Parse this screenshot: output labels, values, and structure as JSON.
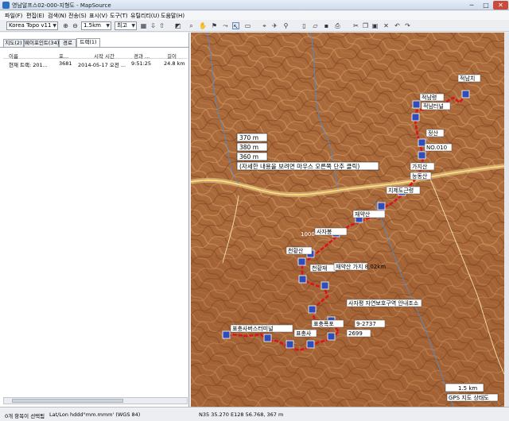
{
  "window": {
    "title": "영남알프스02-000-지형도 - MapSource"
  },
  "menu": [
    "파일(F)",
    "편집(E)",
    "검색(N)",
    "전송(S)",
    "표시(V)",
    "도구(T)",
    "유틸리티(U)",
    "도움말(H)"
  ],
  "toolbar": {
    "map_product": "Korea Topo v11",
    "zoom_scale": "1.5km",
    "detail": "최고"
  },
  "tabs": [
    "지도(2)",
    "웨이포인트(34)",
    "경로",
    "트랙(1)"
  ],
  "track_list": {
    "columns": [
      "이름",
      "포...",
      "시작 시간",
      "경과 ...",
      "길이"
    ],
    "rows": [
      [
        "현재 트랙: 201...",
        "3681",
        "2014-05-17 오전 ...",
        "9:51:25",
        "24.8 km"
      ]
    ]
  },
  "map": {
    "tooltip_lines": [
      "370 m",
      "380 m",
      "360 m",
      "(자세한 내용을 보려면 마우스 오른쪽 단추 클릭)"
    ],
    "waypoints": [
      "적남치",
      "적남령",
      "적남터널",
      "정산",
      "NO.010",
      "가지산",
      "능동산",
      "지제도근령",
      "재약산",
      "1000",
      "사자봉",
      "천황산",
      "천황재",
      "재약산 가지 8.02km",
      "사자평 자연보호구역 안내조소",
      "표충사버스터미널",
      "표충사",
      "표충폭포",
      "9-2737",
      "2699",
      "GPS 지도 상태도"
    ],
    "scale_label": "1.5 km",
    "track_color": "#d9141b",
    "terrain_color": "#a7683c"
  },
  "status": {
    "selection": "0개 항목이 선택됨",
    "coord_format": "Lat/Lon hddd°mm.mmm' (WGS 84)",
    "cursor_position": "N35 35.270 E128 56.768, 367 m"
  }
}
